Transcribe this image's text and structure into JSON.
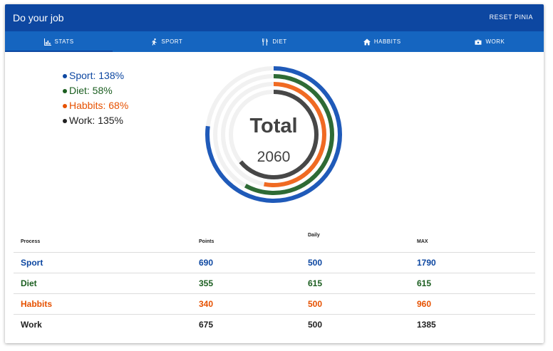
{
  "app": {
    "title": "Do your job",
    "reset_label": "RESET PINIA"
  },
  "tabs": [
    {
      "label": "STATS",
      "icon": "chart-icon",
      "active": true
    },
    {
      "label": "SPORT",
      "icon": "run-icon"
    },
    {
      "label": "DIET",
      "icon": "restaurant-icon"
    },
    {
      "label": "HABBITS",
      "icon": "home-icon"
    },
    {
      "label": "WORK",
      "icon": "briefcase-icon"
    }
  ],
  "legend": [
    {
      "label": "Sport: 138%",
      "color": "#0d47a1"
    },
    {
      "label": "Diet: 58%",
      "color": "#1b5e20"
    },
    {
      "label": "Habbits: 68%",
      "color": "#e65100"
    },
    {
      "label": "Work: 135%",
      "color": "#212121"
    }
  ],
  "donut": {
    "title": "Total",
    "value": "2060",
    "rings": [
      {
        "name": "Sport",
        "fraction": 0.77,
        "color": "#1f5ab9"
      },
      {
        "name": "Diet",
        "fraction": 0.58,
        "color": "#2e6b35"
      },
      {
        "name": "Habbits",
        "fraction": 0.53,
        "color": "#f06a22"
      },
      {
        "name": "Work",
        "fraction": 0.64,
        "color": "#474747"
      }
    ]
  },
  "table": {
    "headers": [
      "Process",
      "Points",
      "Daily",
      "MAX"
    ],
    "rows": [
      {
        "cells": [
          "Sport",
          "690",
          "500",
          "1790"
        ],
        "color": "#0d47a1"
      },
      {
        "cells": [
          "Diet",
          "355",
          "615",
          "615"
        ],
        "color": "#1b5e20"
      },
      {
        "cells": [
          "Habbits",
          "340",
          "500",
          "960"
        ],
        "color": "#e65100"
      },
      {
        "cells": [
          "Work",
          "675",
          "500",
          "1385"
        ],
        "color": "#212121"
      }
    ]
  }
}
